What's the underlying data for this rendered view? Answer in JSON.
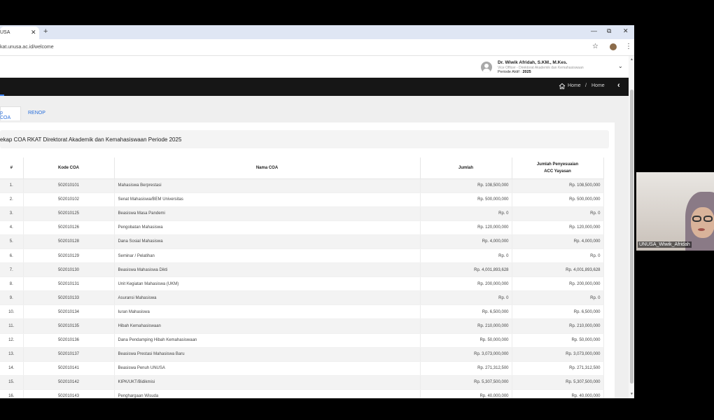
{
  "browser": {
    "tab_title": "USA",
    "url": "kat.unusa.ac.id/welcome"
  },
  "user": {
    "name": "Dr. Wiwik Afridah, S.KM., M.Kes.",
    "role": "Vice Officer - Direktorat Akademik dan Kemahasiswaan",
    "period_label": "Periode Aktif :",
    "period_value": "2025"
  },
  "breadcrumb": {
    "home": "Home",
    "sep": "/",
    "current": "Home"
  },
  "tabs": {
    "rekap": "p COA",
    "renop": "RENOP"
  },
  "card": {
    "title": "ekap COA RKAT Direktorat Akademik dan Kemahasiswaan Periode 2025"
  },
  "table": {
    "headers": {
      "no": "#",
      "kode": "Kode COA",
      "nama": "Nama COA",
      "jumlah": "Jumlah",
      "penyesuaian_1": "Jumlah Penyesuaian",
      "penyesuaian_2": "ACC Yayasan"
    },
    "rows": [
      {
        "no": "1.",
        "kode": "502010101",
        "nama": "Mahasiswa Berprestasi",
        "jumlah": "Rp. 108,500,000",
        "acc": "Rp. 108,500,000"
      },
      {
        "no": "2.",
        "kode": "502010102",
        "nama": "Senat Mahasiswa/BEM Universitas",
        "jumlah": "Rp. 500,000,000",
        "acc": "Rp. 500,000,000"
      },
      {
        "no": "3.",
        "kode": "502010125",
        "nama": "Beasiswa Masa Pandemi",
        "jumlah": "Rp. 0",
        "acc": "Rp. 0"
      },
      {
        "no": "4.",
        "kode": "502010126",
        "nama": "Pengobatan Mahasiswa",
        "jumlah": "Rp. 120,000,000",
        "acc": "Rp. 120,000,000"
      },
      {
        "no": "5.",
        "kode": "502010128",
        "nama": "Dana Sosial Mahasiswa",
        "jumlah": "Rp. 4,000,000",
        "acc": "Rp. 4,000,000"
      },
      {
        "no": "6.",
        "kode": "502010129",
        "nama": "Seminar / Pelatihan",
        "jumlah": "Rp. 0",
        "acc": "Rp. 0"
      },
      {
        "no": "7.",
        "kode": "502010130",
        "nama": "Beasiswa Mahasiswa Dikti",
        "jumlah": "Rp. 4,001,893,628",
        "acc": "Rp. 4,001,893,628"
      },
      {
        "no": "8.",
        "kode": "502010131",
        "nama": "Unit Kegiatan Mahasiswa (UKM)",
        "jumlah": "Rp. 200,000,000",
        "acc": "Rp. 200,000,000"
      },
      {
        "no": "9.",
        "kode": "502010133",
        "nama": "Asuransi Mahasiswa",
        "jumlah": "Rp. 0",
        "acc": "Rp. 0"
      },
      {
        "no": "10.",
        "kode": "502010134",
        "nama": "Iuran Mahasiswa",
        "jumlah": "Rp. 6,500,000",
        "acc": "Rp. 6,500,000"
      },
      {
        "no": "11.",
        "kode": "502010135",
        "nama": "Hibah Kemahasiswaan",
        "jumlah": "Rp. 210,000,000",
        "acc": "Rp. 210,000,000"
      },
      {
        "no": "12.",
        "kode": "502010136",
        "nama": "Dana Pendamping Hibah Kemahasiswaan",
        "jumlah": "Rp. 50,000,000",
        "acc": "Rp. 50,000,000"
      },
      {
        "no": "13.",
        "kode": "502010137",
        "nama": "Beasiswa Prestasi Mahasiswa Baru",
        "jumlah": "Rp. 3,073,000,000",
        "acc": "Rp. 3,073,000,000"
      },
      {
        "no": "14.",
        "kode": "502010141",
        "nama": "Beasiswa Penuh UNUSA",
        "jumlah": "Rp. 271,312,500",
        "acc": "Rp. 271,312,500"
      },
      {
        "no": "15.",
        "kode": "502010142",
        "nama": "KIPK/UKT/Bidikmisi",
        "jumlah": "Rp. 5,307,500,000",
        "acc": "Rp. 5,307,500,000"
      },
      {
        "no": "16.",
        "kode": "502010143",
        "nama": "Penghargaan Wisuda",
        "jumlah": "Rp. 40,000,000",
        "acc": "Rp. 40,000,000"
      }
    ]
  },
  "video": {
    "participant": "UNUSA_Wiwik_Afridah"
  }
}
